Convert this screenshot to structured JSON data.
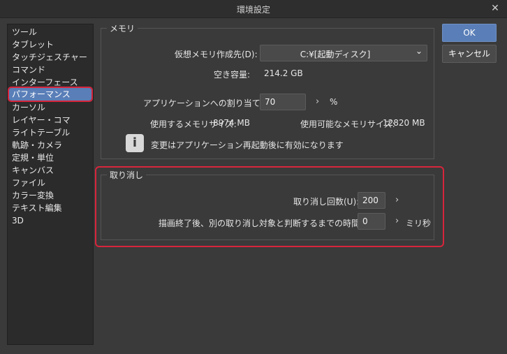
{
  "window": {
    "title": "環境設定",
    "close_label": "✕"
  },
  "sidebar": {
    "items": [
      {
        "label": "ツール"
      },
      {
        "label": "タブレット"
      },
      {
        "label": "タッチジェスチャー"
      },
      {
        "label": "コマンド"
      },
      {
        "label": "インターフェース"
      },
      {
        "label": "パフォーマンス",
        "selected": true
      },
      {
        "label": "カーソル"
      },
      {
        "label": "レイヤー・コマ"
      },
      {
        "label": "ライトテーブル"
      },
      {
        "label": "軌跡・カメラ"
      },
      {
        "label": "定規・単位"
      },
      {
        "label": "キャンバス"
      },
      {
        "label": "ファイル"
      },
      {
        "label": "カラー変換"
      },
      {
        "label": "テキスト編集"
      },
      {
        "label": "3D"
      }
    ]
  },
  "memory": {
    "group_title": "メモリ",
    "location_label": "仮想メモリ作成先(D):",
    "location_value": "C:¥[起動ディスク]",
    "free_label": "空き容量:",
    "free_value": "214.2 GB",
    "alloc_label": "アプリケーションへの割り当て(A):",
    "alloc_value": "70",
    "alloc_unit": "%",
    "used_label": "使用するメモリサイズ:",
    "used_value": "8974 MB",
    "avail_label": "使用可能なメモリサイズ:",
    "avail_value": "12820 MB",
    "info_icon_glyph": "i",
    "info_text": "変更はアプリケーション再起動後に有効になります"
  },
  "undo": {
    "group_title": "取り消し",
    "count_label": "取り消し回数(U):",
    "count_value": "200",
    "time_label": "描画終了後、別の取り消し対象と判断するまでの時間(D):",
    "time_value": "0",
    "time_unit": "ミリ秒"
  },
  "buttons": {
    "ok": "OK",
    "cancel": "キャンセル"
  },
  "colors": {
    "accent": "#5a7fb8",
    "highlight": "#d7253b"
  }
}
